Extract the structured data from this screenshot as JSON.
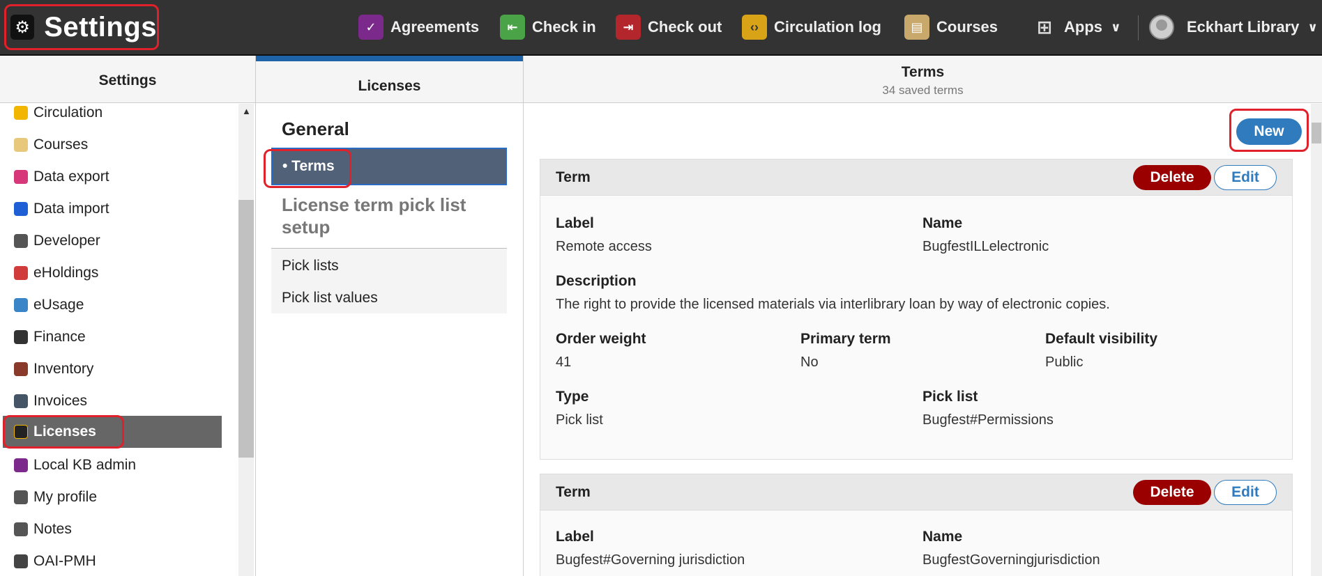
{
  "app": {
    "title": "Settings",
    "gear_icon": "gear-icon"
  },
  "nav": [
    {
      "label": "Agreements",
      "icon": "agreements-icon",
      "color": "#7b2a8c"
    },
    {
      "label": "Check in",
      "icon": "check-in-icon",
      "color": "#4aa347"
    },
    {
      "label": "Check out",
      "icon": "check-out-icon",
      "color": "#b3262b"
    },
    {
      "label": "Circulation log",
      "icon": "circulation-log-icon",
      "color": "#d8a317"
    },
    {
      "label": "Courses",
      "icon": "courses-icon",
      "color": "#c9a96b"
    },
    {
      "label": "Apps",
      "icon": "apps-grid-icon"
    }
  ],
  "user": {
    "name": "Eckhart Library"
  },
  "panes": {
    "settings_header": "Settings",
    "licenses_header": "Licenses",
    "terms_header": "Terms",
    "terms_subheader": "34 saved terms"
  },
  "settings_items": [
    {
      "label": "Circulation",
      "color": "#f2b500"
    },
    {
      "label": "Courses",
      "color": "#e8c87a"
    },
    {
      "label": "Data export",
      "color": "#d6387a"
    },
    {
      "label": "Data import",
      "color": "#1f5fd6"
    },
    {
      "label": "Developer",
      "color": "#555555"
    },
    {
      "label": "eHoldings",
      "color": "#d23b3b"
    },
    {
      "label": "eUsage",
      "color": "#3a85c8"
    },
    {
      "label": "Finance",
      "color": "#333333"
    },
    {
      "label": "Inventory",
      "color": "#8a3a2a"
    },
    {
      "label": "Invoices",
      "color": "#445566"
    },
    {
      "label": "Licenses",
      "color": "#222222",
      "active": true
    },
    {
      "label": "Local KB admin",
      "color": "#7b2a8c"
    },
    {
      "label": "My profile",
      "color": "#555555"
    },
    {
      "label": "Notes",
      "color": "#555555"
    },
    {
      "label": "OAI-PMH",
      "color": "#444444"
    }
  ],
  "licenses_nav": {
    "general_title": "General",
    "terms_label": "• Terms",
    "picklist_title": "License term pick list setup",
    "pick_lists": "Pick lists",
    "pick_list_values": "Pick list values"
  },
  "terms": {
    "new_label": "New",
    "cards": [
      {
        "title": "Term",
        "delete_label": "Delete",
        "edit_label": "Edit",
        "fields": {
          "label_label": "Label",
          "label_value": "Remote access",
          "name_label": "Name",
          "name_value": "BugfestILLelectronic",
          "description_label": "Description",
          "description_value": "The right to provide the licensed materials via interlibrary loan by way of electronic copies.",
          "order_weight_label": "Order weight",
          "order_weight_value": "41",
          "primary_term_label": "Primary term",
          "primary_term_value": "No",
          "default_visibility_label": "Default visibility",
          "default_visibility_value": "Public",
          "type_label": "Type",
          "type_value": "Pick list",
          "pick_list_label": "Pick list",
          "pick_list_value": "Bugfest#Permissions"
        }
      },
      {
        "title": "Term",
        "delete_label": "Delete",
        "edit_label": "Edit",
        "fields": {
          "label_label": "Label",
          "label_value": "Bugfest#Governing jurisdiction",
          "name_label": "Name",
          "name_value": "BugfestGoverningjurisdiction"
        }
      }
    ]
  }
}
